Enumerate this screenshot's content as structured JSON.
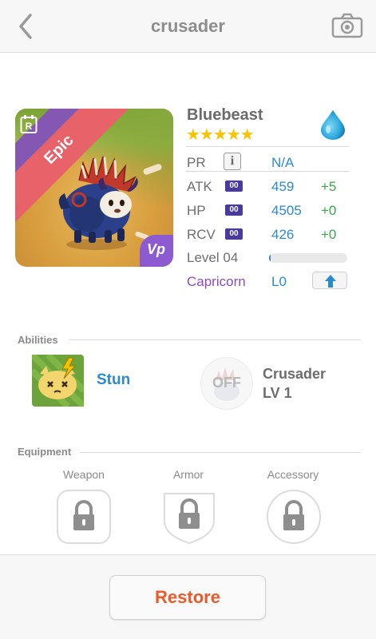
{
  "header": {
    "title": "crusader",
    "back_icon": "chevron-left-icon",
    "camera_icon": "camera-icon"
  },
  "monster": {
    "name": "Bluebeast",
    "stars": "★★★★★",
    "rarity": "Epic",
    "rarity_icon": "R",
    "element_badge": "Vp",
    "element_icon": "water-drop-icon"
  },
  "stats": {
    "pr": {
      "label": "PR",
      "info": "i",
      "value": "N/A"
    },
    "atk": {
      "label": "ATK",
      "badge": "00",
      "value": "459",
      "bonus": "+5"
    },
    "hp": {
      "label": "HP",
      "badge": "00",
      "value": "4505",
      "bonus": "+0"
    },
    "rcv": {
      "label": "RCV",
      "badge": "00",
      "value": "426",
      "bonus": "+0"
    },
    "level": {
      "label": "Level 04",
      "progress": 0.02
    },
    "zodiac": {
      "label": "Capricorn",
      "value": "L0",
      "button_icon": "arrow-up-icon"
    }
  },
  "abilities": {
    "title": "Abilities",
    "skill": {
      "name": "Stun",
      "icon": "stun-icon"
    },
    "leader": {
      "state": "OFF",
      "name": "Crusader",
      "level": "LV 1"
    }
  },
  "equipment": {
    "title": "Equipment",
    "slots": [
      {
        "label": "Weapon",
        "icon": "lock-icon"
      },
      {
        "label": "Armor",
        "icon": "lock-icon"
      },
      {
        "label": "Accessory",
        "icon": "lock-icon"
      }
    ]
  },
  "footer": {
    "restore_label": "Restore"
  },
  "colors": {
    "accent_blue": "#2a8ad0",
    "bonus_green": "#3aa84a",
    "restore_orange": "#ec5a2a",
    "zodiac_purple": "#8b4cc2",
    "star_yellow": "#f6c400"
  }
}
